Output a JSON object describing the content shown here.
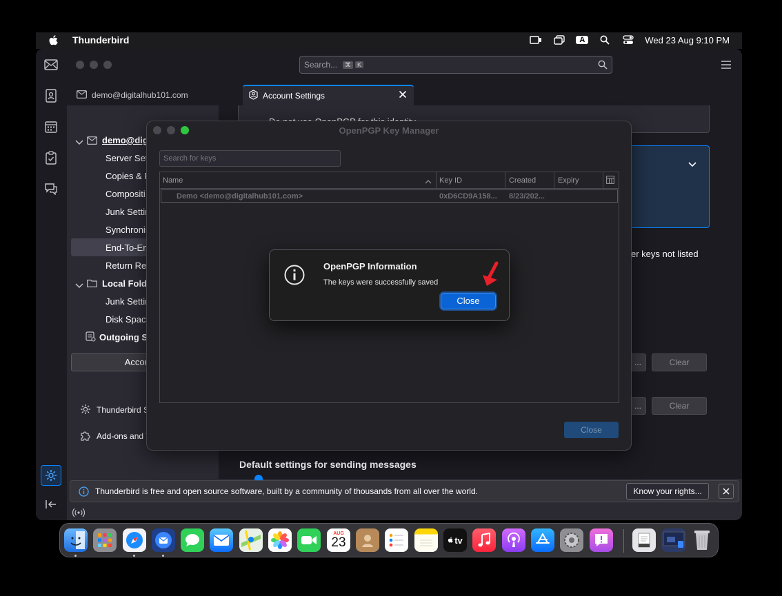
{
  "menubar": {
    "app_name": "Thunderbird",
    "input_badge": "A",
    "datetime": "Wed 23 Aug  9:10 PM"
  },
  "search": {
    "placeholder": "Search...",
    "kbd1": "⌘",
    "kbd2": "K"
  },
  "tabs": {
    "mail_label": "demo@digitalhub101.com",
    "settings_label": "Account Settings"
  },
  "sidebar": {
    "account": "demo@digi",
    "items": [
      "Server Set",
      "Copies & F",
      "Compositi",
      "Junk Settin",
      "Synchronis",
      "End-To-En",
      "Return Rec"
    ],
    "local_folders": "Local Folde",
    "local_items": [
      "Junk Settin",
      "Disk Space"
    ],
    "outgoing": "Outgoing S",
    "account_actions": "Account A",
    "thunderbird_settings": "Thunderbird S",
    "addons": "Add-ons and T"
  },
  "content": {
    "top_text": "Do not use OpenPGP for this identity",
    "other_keys_text": "er keys not listed",
    "clear1": "Clear",
    "clear2": "Clear",
    "browse1": "...",
    "browse2": "...",
    "default_sending": "Default settings for sending messages"
  },
  "key_manager": {
    "title": "OpenPGP Key Manager",
    "search_placeholder": "Search for keys",
    "columns": [
      "Name",
      "Key ID",
      "Created",
      "Expiry"
    ],
    "rows": [
      {
        "name": "Demo <demo@digitalhub101.com>",
        "key_id": "0xD6CD9A158...",
        "created": "8/23/202...",
        "expiry": ""
      }
    ],
    "close_label": "Close"
  },
  "alert": {
    "title": "OpenPGP Information",
    "message": "The keys were successfully saved",
    "close_label": "Close"
  },
  "infobar": {
    "message": "Thunderbird is free and open source software, built by a community of thousands from all over the world.",
    "button": "Know your rights..."
  },
  "dock": {
    "calendar_month": "AUG",
    "calendar_day": "23",
    "tv_label": "tv"
  },
  "colors": {
    "accent": "#0a84ff",
    "dialog_button": "#0a64d6",
    "annotation_arrow": "#e8202a"
  }
}
